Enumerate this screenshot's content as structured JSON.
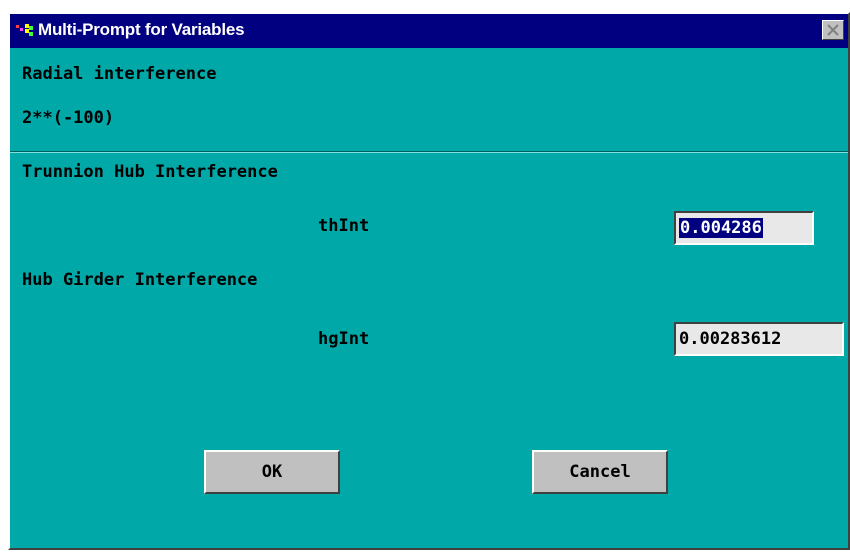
{
  "window": {
    "title": "Multi-Prompt for Variables"
  },
  "header": {
    "description": "Radial interference",
    "expression": "2**(-100)"
  },
  "groups": [
    {
      "heading": "Trunnion Hub Interference",
      "variable": "thInt",
      "value": "0.004286",
      "selected": true
    },
    {
      "heading": "Hub Girder Interference",
      "variable": "hgInt",
      "value": "0.00283612",
      "selected": false
    }
  ],
  "buttons": {
    "ok_label": "OK",
    "cancel_label": "Cancel"
  },
  "colors": {
    "dialog_background": "#00a8a8",
    "titlebar": "#000080",
    "selection": "#000080",
    "button_face": "#c0c0c0",
    "field_background": "#e8e8e8"
  }
}
